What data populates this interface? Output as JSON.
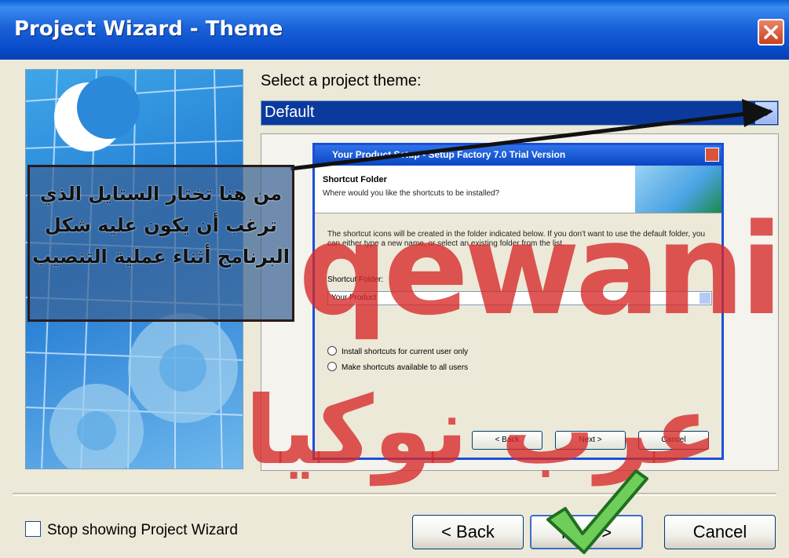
{
  "window": {
    "title": "Project Wizard - Theme"
  },
  "theme": {
    "label": "Select a project theme:",
    "selected": "Default"
  },
  "preview": {
    "title": "Your Product Setup - Setup Factory 7.0 Trial Version",
    "header_title": "Shortcut Folder",
    "header_subtitle": "Where would you like the shortcuts to be installed?",
    "description": "The shortcut icons will be created in the folder indicated below. If you don't want to use the default folder, you can either type a new name, or select an existing folder from the list.",
    "folder_label": "Shortcut Folder:",
    "folder_value": "Your Product",
    "radio_current_user": "Install shortcuts for current user only",
    "radio_all_users": "Make shortcuts available to all users",
    "back_label": "< Back",
    "next_label": "Next >",
    "cancel_label": "Cancel"
  },
  "callout": {
    "text": "من هنا تختار الستايل الذي ترغب أن يكون عليه شكل البرنامج أثناء عملية التنصيب"
  },
  "watermark": {
    "latin": "qewani",
    "arabic": "عرب نوكيا"
  },
  "footer": {
    "checkbox_label": "Stop showing Project Wizard",
    "back_label": "< Back",
    "next_label": "Next >",
    "cancel_label": "Cancel"
  },
  "colors": {
    "title_bar": "#1b63d9",
    "select_highlight": "#0b3a9e",
    "watermark": "#d62828",
    "checkmark": "#3aa63a"
  }
}
